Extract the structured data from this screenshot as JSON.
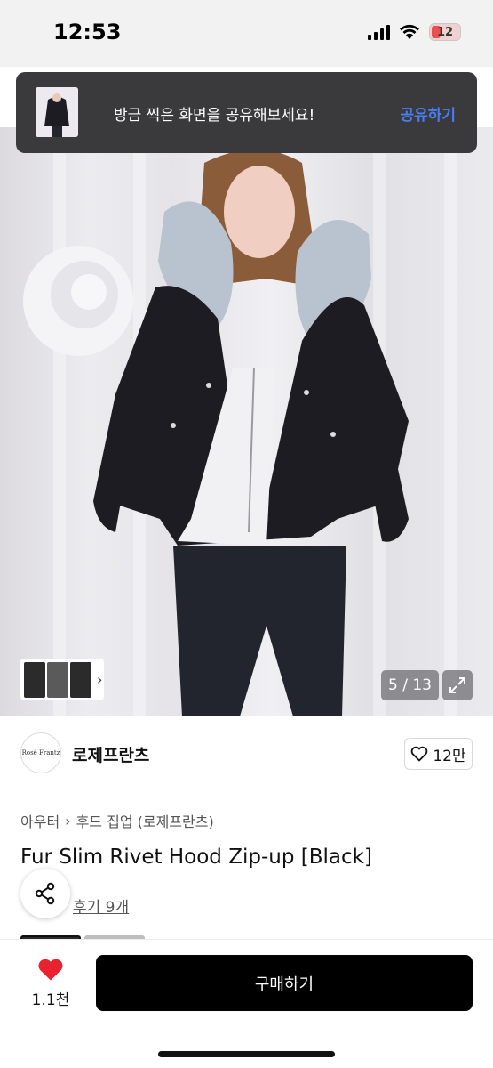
{
  "status_bar": {
    "time": "12:53",
    "battery": "12"
  },
  "toast": {
    "message": "방금 찍은 화면을 공유해보세요!",
    "action": "공유하기"
  },
  "gallery": {
    "counter": "5 / 13"
  },
  "brand": {
    "name": "로제프란츠",
    "logo_text": "Rosé Frantz",
    "likes": "12만"
  },
  "breadcrumb": {
    "category": "아우터",
    "subcategory": "후드 집업 (로제프란츠)"
  },
  "product": {
    "title": "Fur Slim Rivet Hood Zip-up [Black]",
    "reviews": "후기 9개"
  },
  "bottom": {
    "wish_count": "1.1천",
    "buy_label": "구매하기"
  },
  "colors": {
    "accent_blue": "#4a7ef0",
    "heart_red": "#e8222f",
    "button_black": "#000000",
    "toast_bg": "#3a3a3c"
  },
  "icons": [
    "signal-icon",
    "wifi-icon",
    "battery-icon",
    "chevron-right-icon",
    "expand-icon",
    "heart-outline-icon",
    "share-icon",
    "heart-filled-icon"
  ]
}
